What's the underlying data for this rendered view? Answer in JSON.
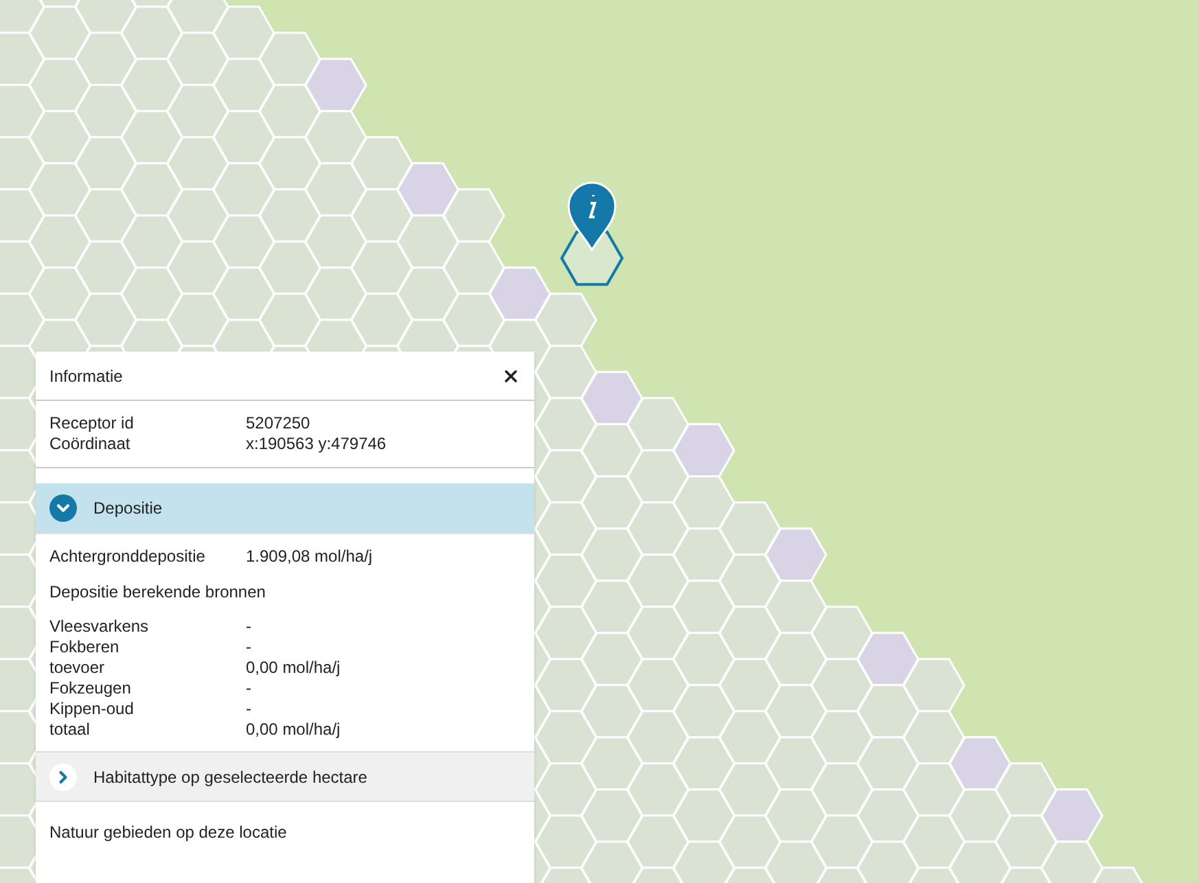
{
  "info_panel": {
    "title": "Informatie",
    "receptor": [
      {
        "label": "Receptor id",
        "value": "5207250"
      },
      {
        "label": "Coördinaat",
        "value": "x:190563 y:479746"
      }
    ],
    "sections": [
      {
        "title": "Depositie",
        "expanded": true,
        "background": {
          "label": "Achtergronddepositie",
          "value": "1.909,08 mol/ha/j"
        },
        "subtitle": "Depositie berekende bronnen",
        "sources": [
          {
            "label": "Vleesvarkens",
            "value": "-"
          },
          {
            "label": "Fokberen",
            "value": "-"
          },
          {
            "label": "toevoer",
            "value": "0,00 mol/ha/j"
          },
          {
            "label": "Fokzeugen",
            "value": "-"
          },
          {
            "label": "Kippen-oud",
            "value": "-"
          },
          {
            "label": "totaal",
            "value": "0,00 mol/ha/j"
          }
        ]
      },
      {
        "title": "Habitattype op geselecteerde hectare",
        "expanded": false
      }
    ],
    "footer_heading": "Natuur gebieden op deze locatie"
  }
}
